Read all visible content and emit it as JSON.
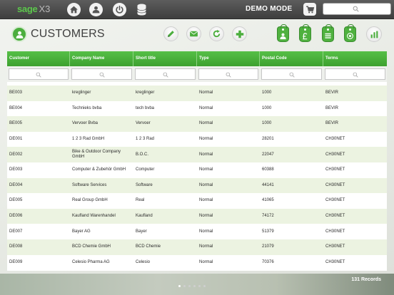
{
  "app": {
    "brand": "sage",
    "brand_suffix": "X3",
    "mode_label": "DEMO MODE",
    "accent": "#4cae3e"
  },
  "nav": {
    "icons": [
      "home-icon",
      "user-icon",
      "power-icon",
      "database-icon",
      "cart-icon",
      "search-icon"
    ]
  },
  "page": {
    "title": "CUSTOMERS",
    "actions": [
      "edit-icon",
      "email-icon",
      "refresh-icon",
      "add-icon"
    ],
    "tags": [
      "person-tag-icon",
      "pound-tag-icon",
      "list-tag-icon",
      "contact-tag-icon",
      "chart-icon"
    ]
  },
  "table": {
    "columns": [
      "Customer",
      "Company Name",
      "Short title",
      "Type",
      "Postal Code",
      "Terms"
    ],
    "rows": [
      [
        "BE003",
        "kreglinger",
        "kreglinger",
        "Normal",
        "1000",
        "BEVIR"
      ],
      [
        "BE004",
        "Technieks bvba",
        "tech bvba",
        "Normal",
        "1000",
        "BEVIR"
      ],
      [
        "BE005",
        "Vervoer Bvba",
        "Vervoer",
        "Normal",
        "1000",
        "BEVIR"
      ],
      [
        "DE001",
        "1 2 3 Rad GmbH",
        "1 2 3 Rad",
        "Normal",
        "28201",
        "CH30NET"
      ],
      [
        "DE002",
        "Bike & Outdoor Company GmbH",
        "B.O.C.",
        "Normal",
        "22047",
        "CH30NET"
      ],
      [
        "DE003",
        "Computer & Zubehör GmbH",
        "Computer",
        "Normal",
        "60388",
        "CH30NET"
      ],
      [
        "DE004",
        "Software Services",
        "Software",
        "Normal",
        "44141",
        "CH30NET"
      ],
      [
        "DE005",
        "Real Group GmbH",
        "Real",
        "Normal",
        "41065",
        "CH30NET"
      ],
      [
        "DE006",
        "Kaufland Warenhandel",
        "Kaufland",
        "Normal",
        "74172",
        "CH30NET"
      ],
      [
        "DE007",
        "Bayer AG",
        "Bayer",
        "Normal",
        "51379",
        "CH30NET"
      ],
      [
        "DE008",
        "BCD Chemie GmbH",
        "BCD Chemie",
        "Normal",
        "21079",
        "CH30NET"
      ],
      [
        "DE009",
        "Celesio Pharma AG",
        "Celesio",
        "Normal",
        "70376",
        "CH30NET"
      ]
    ]
  },
  "footer": {
    "records": "131 Records",
    "pages": 6,
    "active_page": 1
  }
}
